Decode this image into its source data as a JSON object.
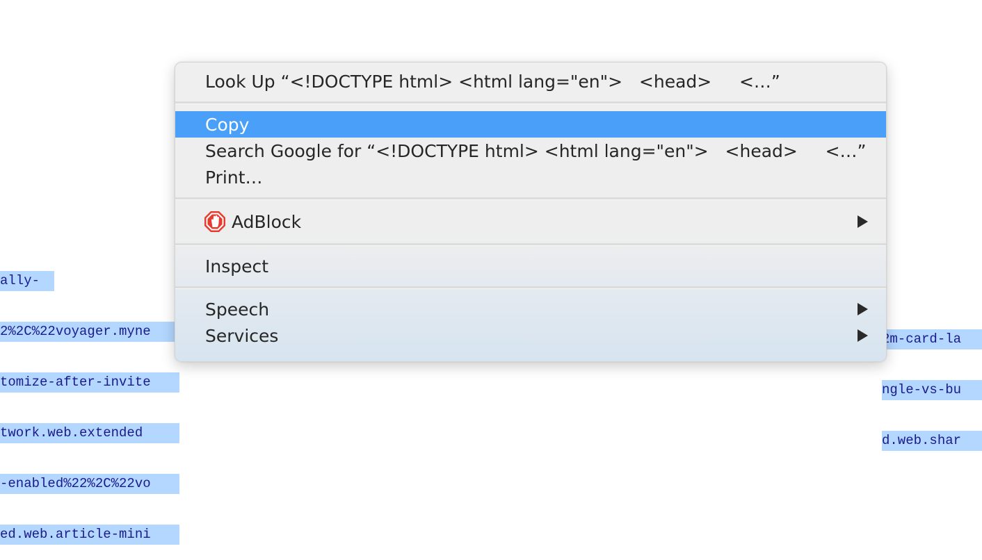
{
  "background_text": {
    "left_lines": [
      "ally-",
      "2%2C%22voyager.myne",
      "tomize-after-invite",
      "twork.web.extended",
      "-enabled%22%2C%22vo",
      "ed.web.article-mini"
    ],
    "right_lines": [
      "2m-card-la",
      "ngle-vs-bu",
      "d.web.shar"
    ]
  },
  "menu": {
    "look_up_label": "Look Up “<!DOCTYPE html> <html lang=\"en\">   <head>     <…”",
    "copy_label": "Copy",
    "search_label": "Search Google for “<!DOCTYPE html> <html lang=\"en\">   <head>     <…”",
    "print_label": "Print…",
    "adblock_label": "AdBlock",
    "inspect_label": "Inspect",
    "speech_label": "Speech",
    "services_label": "Services"
  },
  "icons": {
    "adblock": "adblock-icon",
    "submenu": "chevron-right-icon"
  },
  "colors": {
    "highlight": "#4a9ff9",
    "selection": "#b3d7ff",
    "adblock_red": "#e63b2e"
  }
}
